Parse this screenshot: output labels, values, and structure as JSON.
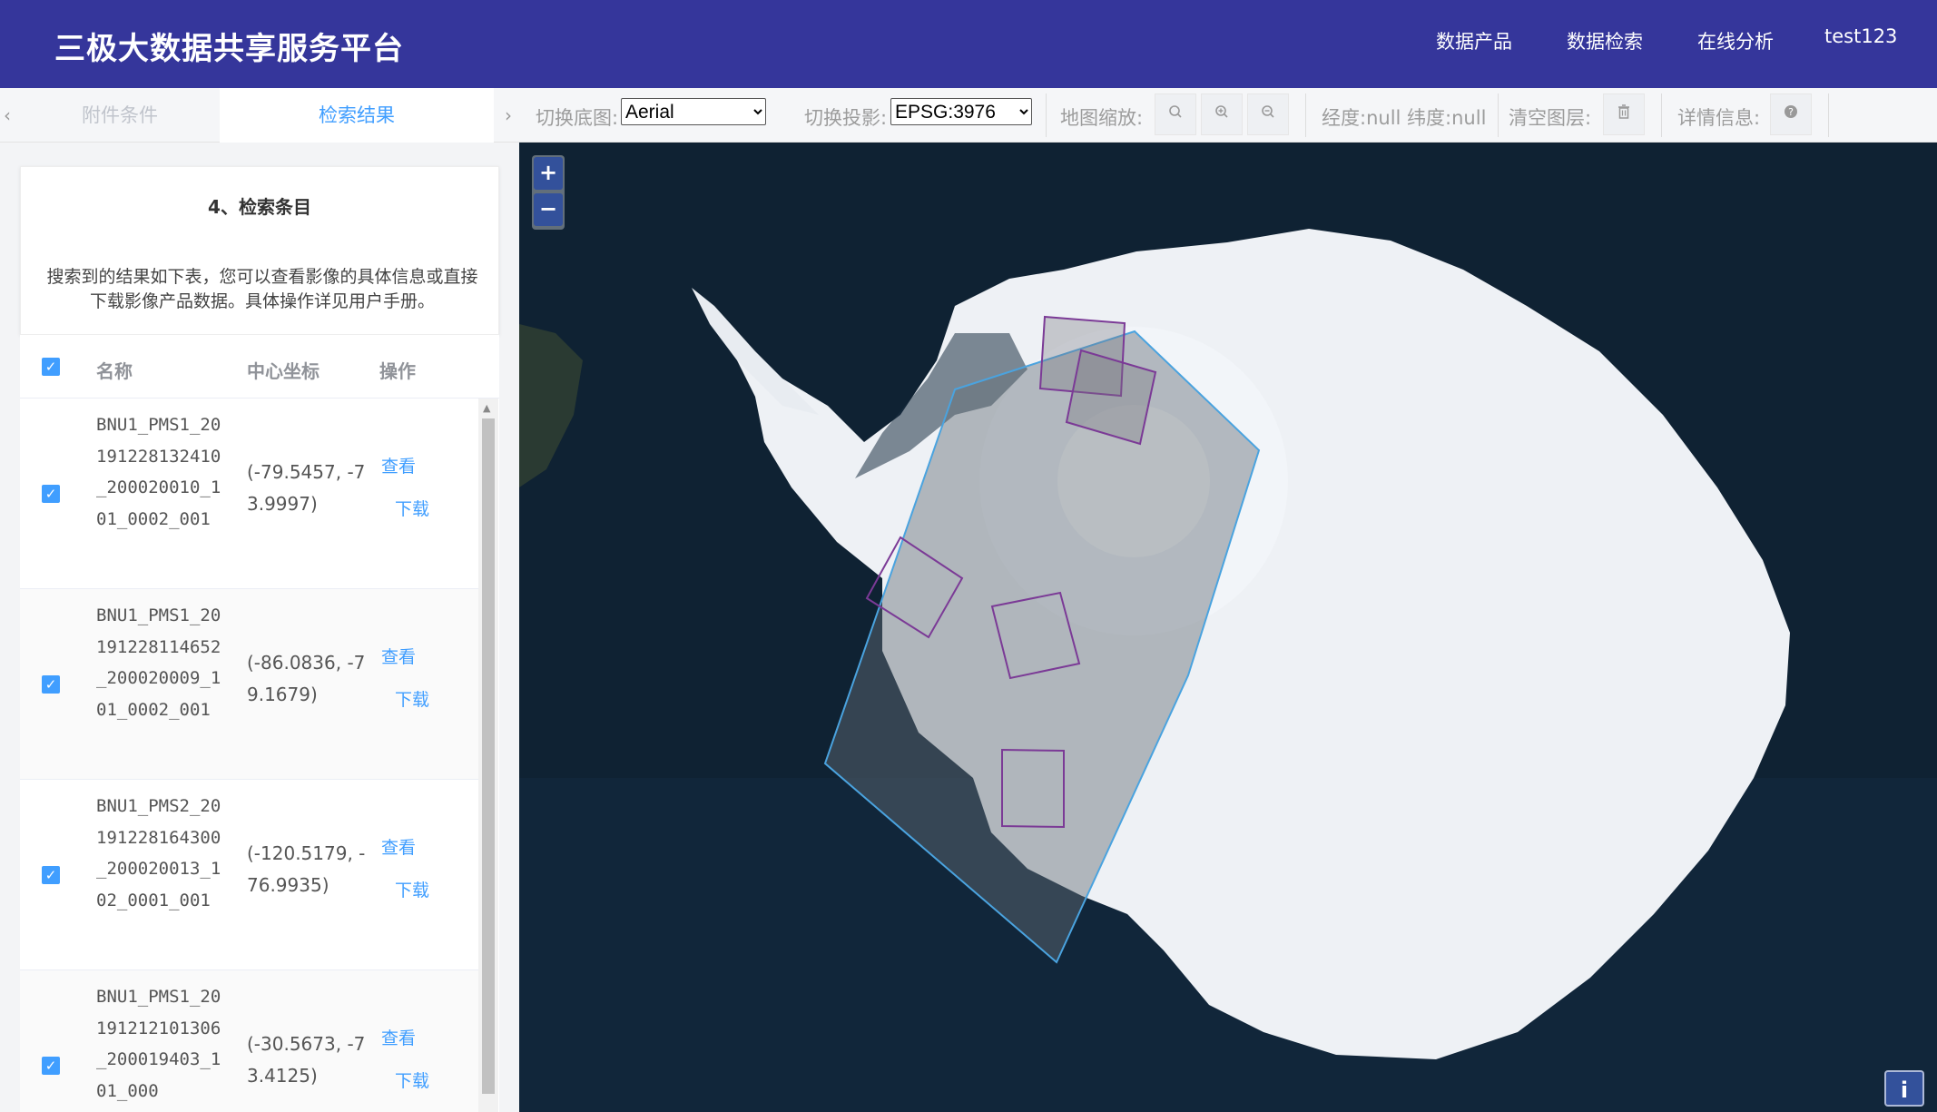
{
  "header": {
    "title": "三极大数据共享服务平台",
    "nav": [
      "数据产品",
      "数据检索",
      "在线分析",
      "test123"
    ]
  },
  "tabs": {
    "left_arrow": "‹",
    "right_arrow": "›",
    "inactive": "附件条件",
    "active": "检索结果"
  },
  "toolbar": {
    "basemap_label": "切换底图:",
    "basemap_value": "Aerial",
    "projection_label": "切换投影:",
    "projection_value": "EPSG:3976",
    "zoom_label": "地图缩放:",
    "lonlat": "经度:null  纬度:null",
    "clear_label": "清空图层:",
    "details_label": "详情信息:"
  },
  "card": {
    "title": "4、检索条目",
    "desc": "搜索到的结果如下表，您可以查看影像的具体信息或直接下载影像产品数据。具体操作详见用户手册。"
  },
  "table": {
    "headers": {
      "name": "名称",
      "center": "中心坐标",
      "action": "操作"
    },
    "rows": [
      {
        "name": "BNU1_PMS1_20191228132410_200020010_101_0002_001",
        "coord": "(-79.5457, -73.9997)",
        "view": "查看",
        "download": "下载"
      },
      {
        "name": "BNU1_PMS1_20191228114652_200020009_101_0002_001",
        "coord": "(-86.0836, -79.1679)",
        "view": "查看",
        "download": "下载"
      },
      {
        "name": "BNU1_PMS2_20191228164300_200020013_102_0001_001",
        "coord": "(-120.5179, -76.9935)",
        "view": "查看",
        "download": "下载"
      },
      {
        "name": "BNU1_PMS1_20191212101306_200019403_101_000",
        "coord": "(-30.5673, -73.4125)",
        "view": "查看",
        "download": "下载"
      }
    ]
  },
  "map": {
    "zoom_in": "+",
    "zoom_out": "−",
    "info": "i",
    "colors": {
      "ocean": "#0f2233",
      "ice": "#eef1f5",
      "footprint": "#4aa3df",
      "scene": "#7b3a96"
    }
  }
}
